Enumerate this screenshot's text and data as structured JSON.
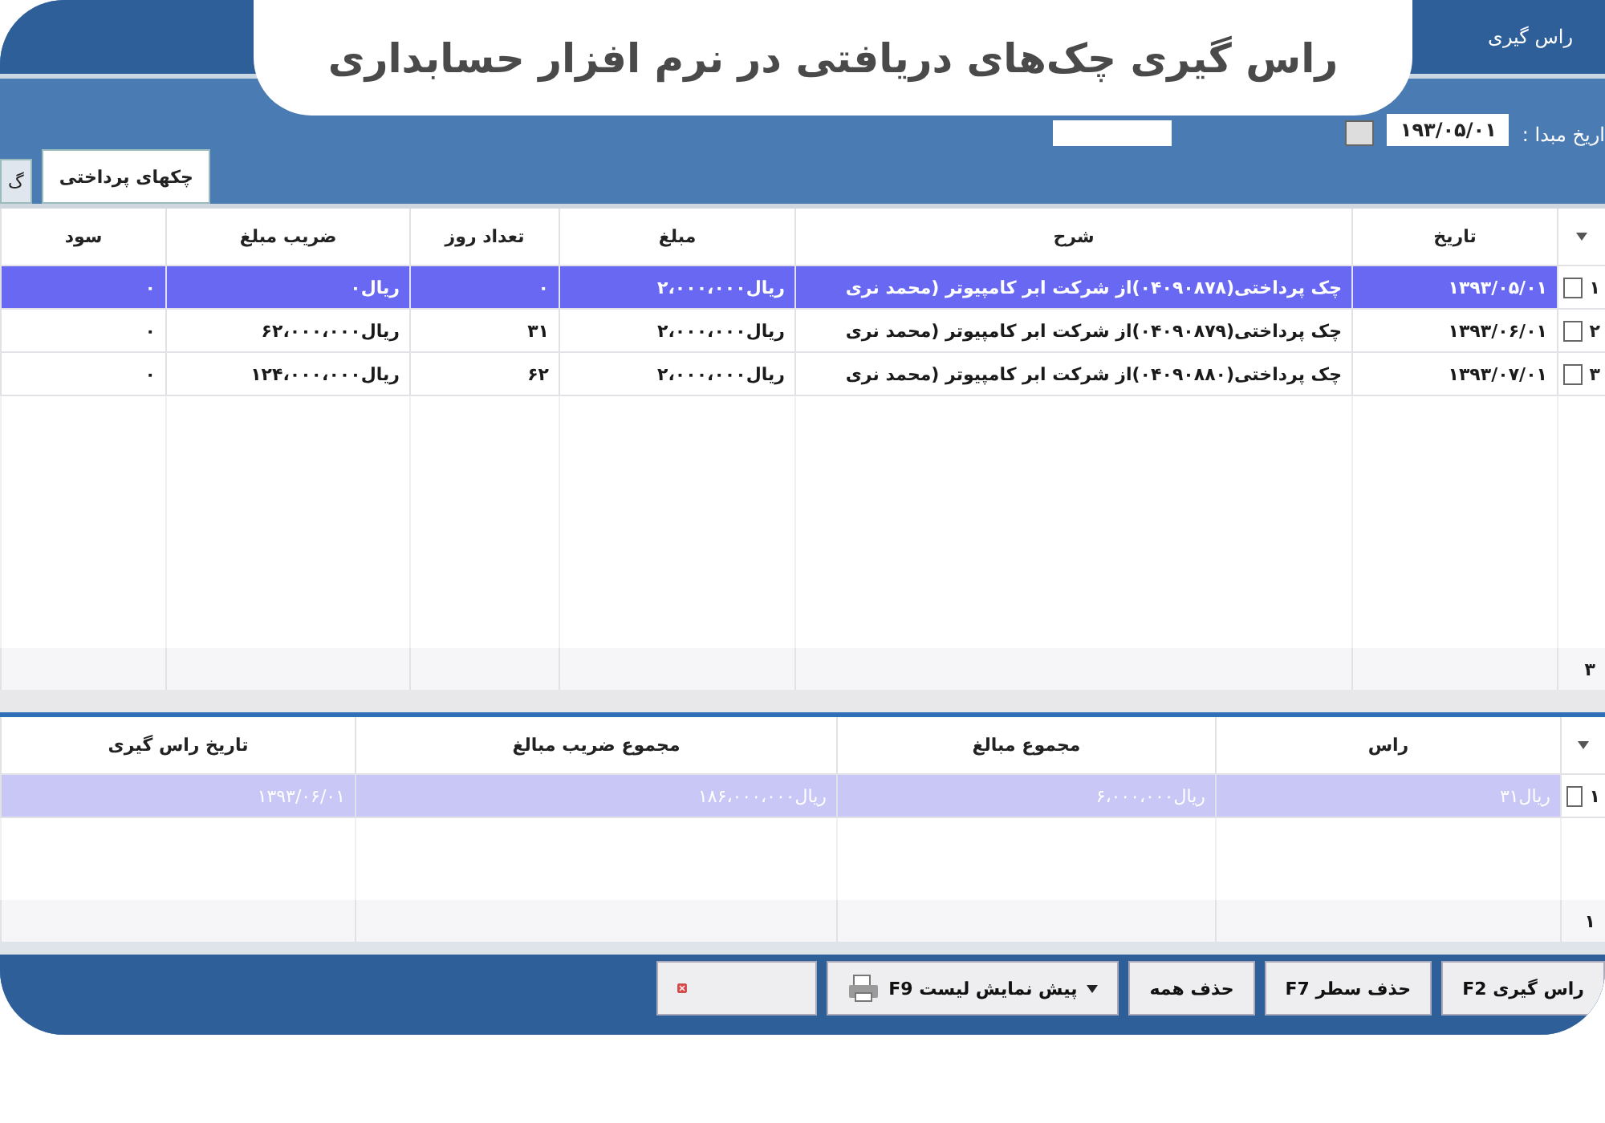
{
  "banner": {
    "title": "راس گیری چک‌های دریافتی در نرم افزار حسابداری"
  },
  "window": {
    "title": "راس گیری"
  },
  "filter": {
    "label": "اریخ مبدا :",
    "date": "۱۹۳/۰۵/۰۱"
  },
  "tabs": [
    {
      "label": "چکهای پرداختی",
      "selected": true
    },
    {
      "label": "گ",
      "selected": false
    }
  ],
  "table": {
    "columns": [
      "تاریخ",
      "شرح",
      "مبلغ",
      "تعداد روز",
      "ضریب مبلغ",
      "سود"
    ],
    "rows": [
      {
        "number": "۱",
        "checked": false,
        "selected": true,
        "cells": [
          "۱۳۹۳/۰۵/۰۱",
          "چک پرداختی(۰۴۰۹۰۸۷۸)از شرکت ابر کامپیوتر (محمد نری",
          "ریال۲،۰۰۰،۰۰۰",
          "۰",
          "ریال۰",
          "۰"
        ]
      },
      {
        "number": "۲",
        "checked": false,
        "selected": false,
        "cells": [
          "۱۳۹۳/۰۶/۰۱",
          "چک پرداختی(۰۴۰۹۰۸۷۹)از شرکت ابر کامپیوتر (محمد نری",
          "ریال۲،۰۰۰،۰۰۰",
          "۳۱",
          "ریال۶۲،۰۰۰،۰۰۰",
          "۰"
        ]
      },
      {
        "number": "۳",
        "checked": false,
        "selected": false,
        "cells": [
          "۱۳۹۳/۰۷/۰۱",
          "چک پرداختی(۰۴۰۹۰۸۸۰)از شرکت ابر کامپیوتر (محمد نری",
          "ریال۲،۰۰۰،۰۰۰",
          "۶۲",
          "ریال۱۲۴،۰۰۰،۰۰۰",
          "۰"
        ]
      }
    ],
    "footer": "۳"
  },
  "summary": {
    "columns": [
      "راس",
      "مجموع مبالغ",
      "مجموع ضریب مبالغ",
      "تاریخ راس گیری"
    ],
    "rows": [
      {
        "number": "۱",
        "checked": false,
        "selected": true,
        "cells": [
          "ریال۳۱",
          "ریال۶،۰۰۰،۰۰۰",
          "ریال۱۸۶،۰۰۰،۰۰۰",
          "۱۳۹۳/۰۶/۰۱"
        ]
      }
    ],
    "footer": "۱"
  },
  "buttons": [
    {
      "kind": "text",
      "label": "راس گیری F2"
    },
    {
      "kind": "text",
      "label": "حذف سطر F7"
    },
    {
      "kind": "text",
      "label": "حذف همه"
    },
    {
      "kind": "print",
      "label": "پیش نمایش لیست F9"
    },
    {
      "kind": "close"
    }
  ]
}
